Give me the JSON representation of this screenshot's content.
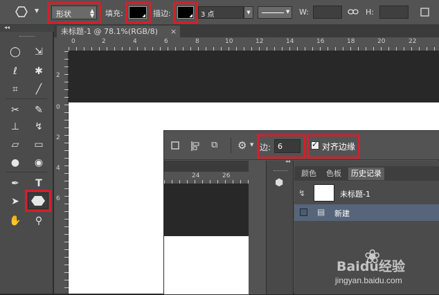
{
  "options_bar": {
    "mode_label": "形状",
    "fill_label": "填充:",
    "stroke_label": "描边:",
    "stroke_width": "3 点",
    "w_label": "W:",
    "h_label": "H:"
  },
  "document": {
    "tab_title": "未标题-1 @ 78.1%(RGB/8)",
    "close_glyph": "×",
    "ruler_top": [
      "0",
      "2",
      "4",
      "6",
      "8",
      "10",
      "12",
      "14",
      "16",
      "18",
      "20",
      "22"
    ],
    "ruler_left": [
      "2",
      "0",
      "2",
      "4",
      "6"
    ]
  },
  "overlay": {
    "sides_label": "边:",
    "sides_value": "6",
    "align_edges_label": "对齐边缘",
    "align_edges_checked": true,
    "ruler_top": [
      "24",
      "26"
    ],
    "panel_tabs": [
      "颜色",
      "色板",
      "历史记录"
    ],
    "active_tab": "历史记录",
    "history_snapshot": "未标题-1",
    "history_item": "新建"
  },
  "watermark": {
    "brand": "Baidu经验",
    "url": "jingyan.baidu.com"
  },
  "colors": {
    "highlight": "#d4202a",
    "selection": "#56657a"
  }
}
